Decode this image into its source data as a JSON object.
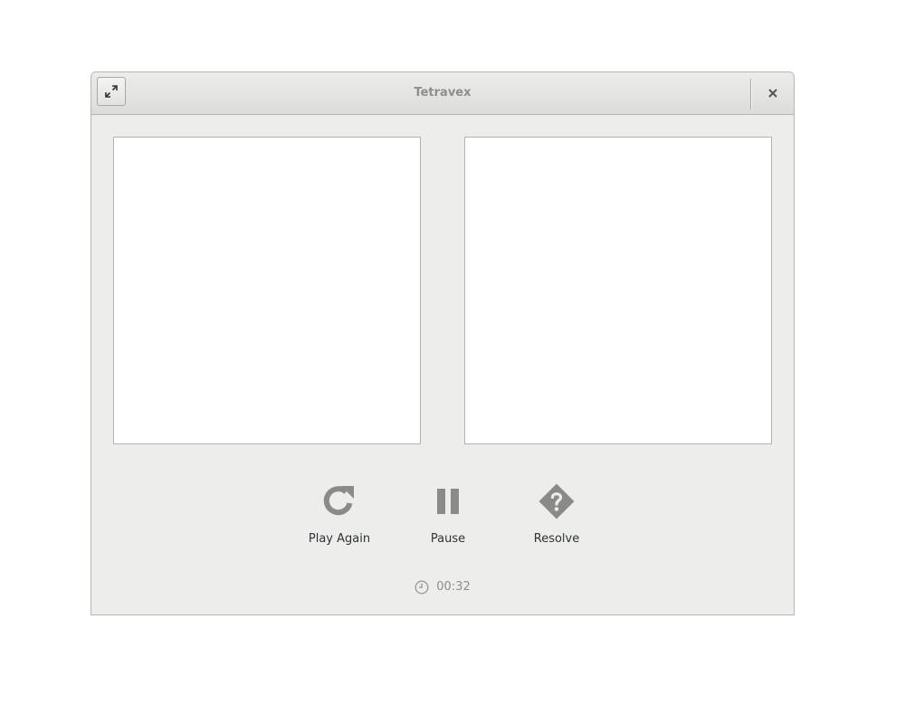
{
  "window": {
    "title": "Tetravex"
  },
  "titlebar": {
    "fullscreen_icon": "fullscreen-icon",
    "close_icon": "close-icon"
  },
  "controls": {
    "play_again": {
      "label": "Play Again",
      "icon": "redo-icon"
    },
    "pause": {
      "label": "Pause",
      "icon": "pause-icon"
    },
    "resolve": {
      "label": "Resolve",
      "icon": "question-diamond-icon"
    }
  },
  "timer": {
    "icon": "clock-icon",
    "value": "00:32"
  },
  "colors": {
    "icon_gray": "#8a8a88",
    "label_text": "#2e3436",
    "window_bg": "#ededeb",
    "board_bg": "#ffffff"
  }
}
